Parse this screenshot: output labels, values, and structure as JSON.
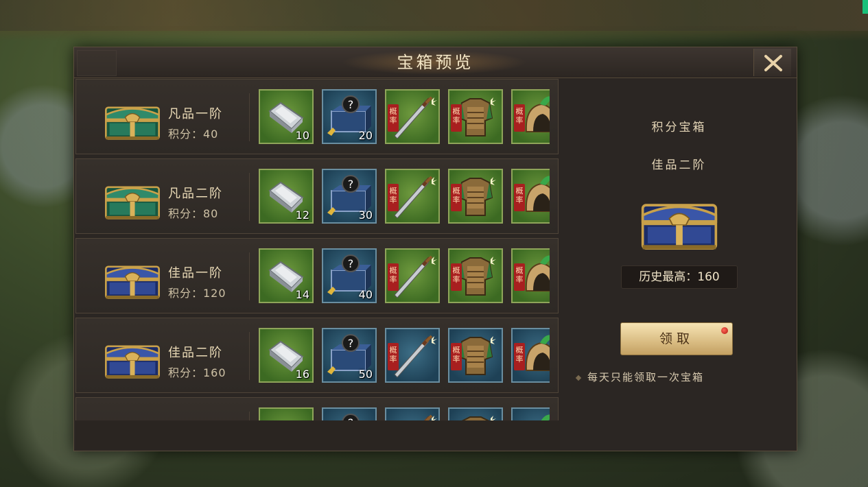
{
  "dialog": {
    "title": "宝箱预览"
  },
  "rows": [
    {
      "name": "凡品一阶",
      "score": "积分：40",
      "chest": "green",
      "items": [
        {
          "kind": "silver",
          "bg": "green",
          "count": "10"
        },
        {
          "kind": "mystery",
          "bg": "blue",
          "count": "20"
        },
        {
          "kind": "sword",
          "bg": "green",
          "tag": "概率"
        },
        {
          "kind": "armor",
          "bg": "green",
          "tag": "概率"
        },
        {
          "kind": "helmet",
          "bg": "green",
          "tag": "概率"
        }
      ]
    },
    {
      "name": "凡品二阶",
      "score": "积分：80",
      "chest": "green",
      "items": [
        {
          "kind": "silver",
          "bg": "green",
          "count": "12"
        },
        {
          "kind": "mystery",
          "bg": "blue",
          "count": "30"
        },
        {
          "kind": "sword",
          "bg": "green",
          "tag": "概率"
        },
        {
          "kind": "armor",
          "bg": "green",
          "tag": "概率"
        },
        {
          "kind": "helmet",
          "bg": "green",
          "tag": "概率"
        }
      ]
    },
    {
      "name": "佳品一阶",
      "score": "积分：120",
      "chest": "blue",
      "items": [
        {
          "kind": "silver",
          "bg": "green",
          "count": "14"
        },
        {
          "kind": "mystery",
          "bg": "blue",
          "count": "40"
        },
        {
          "kind": "sword",
          "bg": "green",
          "tag": "概率"
        },
        {
          "kind": "armor",
          "bg": "green",
          "tag": "概率"
        },
        {
          "kind": "helmet",
          "bg": "green",
          "tag": "概率"
        }
      ]
    },
    {
      "name": "佳品二阶",
      "score": "积分：160",
      "chest": "blue",
      "items": [
        {
          "kind": "silver",
          "bg": "green",
          "count": "16"
        },
        {
          "kind": "mystery",
          "bg": "blue",
          "count": "50"
        },
        {
          "kind": "sword",
          "bg": "blue",
          "tag": "概率"
        },
        {
          "kind": "armor",
          "bg": "blue",
          "tag": "概率"
        },
        {
          "kind": "helmet",
          "bg": "blue",
          "tag": "概率"
        }
      ]
    },
    {
      "name": "",
      "score": "",
      "chest": "blue",
      "items": [
        {
          "kind": "silver",
          "bg": "green"
        },
        {
          "kind": "mystery",
          "bg": "blue"
        },
        {
          "kind": "sword",
          "bg": "blue"
        },
        {
          "kind": "armor",
          "bg": "blue"
        },
        {
          "kind": "helmet",
          "bg": "blue"
        }
      ]
    }
  ],
  "detail": {
    "category": "积分宝箱",
    "tier": "佳品二阶",
    "history_best": "历史最高：160",
    "claim_label": "领取",
    "note": "每天只能领取一次宝箱"
  },
  "colors": {
    "accent": "#d9bc82",
    "panel": "#2b2623",
    "text": "#ecdcb8"
  }
}
